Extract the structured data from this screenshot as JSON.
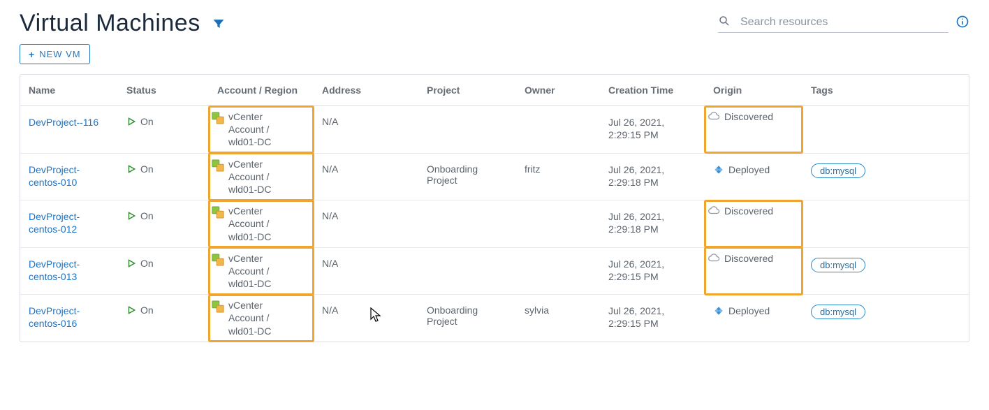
{
  "header": {
    "title": "Virtual Machines",
    "new_vm_label": "NEW VM",
    "search_placeholder": "Search resources"
  },
  "columns": {
    "name": "Name",
    "status": "Status",
    "account": "Account / Region",
    "address": "Address",
    "project": "Project",
    "owner": "Owner",
    "creation": "Creation Time",
    "origin": "Origin",
    "tags": "Tags"
  },
  "common": {
    "account_text": "vCenter Account / wld01-DC",
    "status_on": "On",
    "na": "N/A",
    "origin_discovered": "Discovered",
    "origin_deployed": "Deployed",
    "tag_dbmysql": "db:mysql"
  },
  "rows": [
    {
      "name": "DevProject--116",
      "status": "On",
      "account": "vCenter Account / wld01-DC",
      "address": "N/A",
      "project": "",
      "owner": "",
      "creation": "Jul 26, 2021, 2:29:15 PM",
      "origin": "Discovered",
      "origin_kind": "discovered",
      "tags": [],
      "highlight_origin": true
    },
    {
      "name": "DevProject-centos-010",
      "status": "On",
      "account": "vCenter Account / wld01-DC",
      "address": "N/A",
      "project": "Onboarding Project",
      "owner": "fritz",
      "creation": "Jul 26, 2021, 2:29:18 PM",
      "origin": "Deployed",
      "origin_kind": "deployed",
      "tags": [
        "db:mysql"
      ],
      "highlight_origin": false
    },
    {
      "name": "DevProject-centos-012",
      "status": "On",
      "account": "vCenter Account / wld01-DC",
      "address": "N/A",
      "project": "",
      "owner": "",
      "creation": "Jul 26, 2021, 2:29:18 PM",
      "origin": "Discovered",
      "origin_kind": "discovered",
      "tags": [],
      "highlight_origin": true
    },
    {
      "name": "DevProject-centos-013",
      "status": "On",
      "account": "vCenter Account / wld01-DC",
      "address": "N/A",
      "project": "",
      "owner": "",
      "creation": "Jul 26, 2021, 2:29:15 PM",
      "origin": "Discovered",
      "origin_kind": "discovered",
      "tags": [
        "db:mysql"
      ],
      "highlight_origin": true
    },
    {
      "name": "DevProject-centos-016",
      "status": "On",
      "account": "vCenter Account / wld01-DC",
      "address": "N/A",
      "project": "Onboarding Project",
      "owner": "sylvia",
      "creation": "Jul 26, 2021, 2:29:15 PM",
      "origin": "Deployed",
      "origin_kind": "deployed",
      "tags": [
        "db:mysql"
      ],
      "highlight_origin": false
    }
  ]
}
